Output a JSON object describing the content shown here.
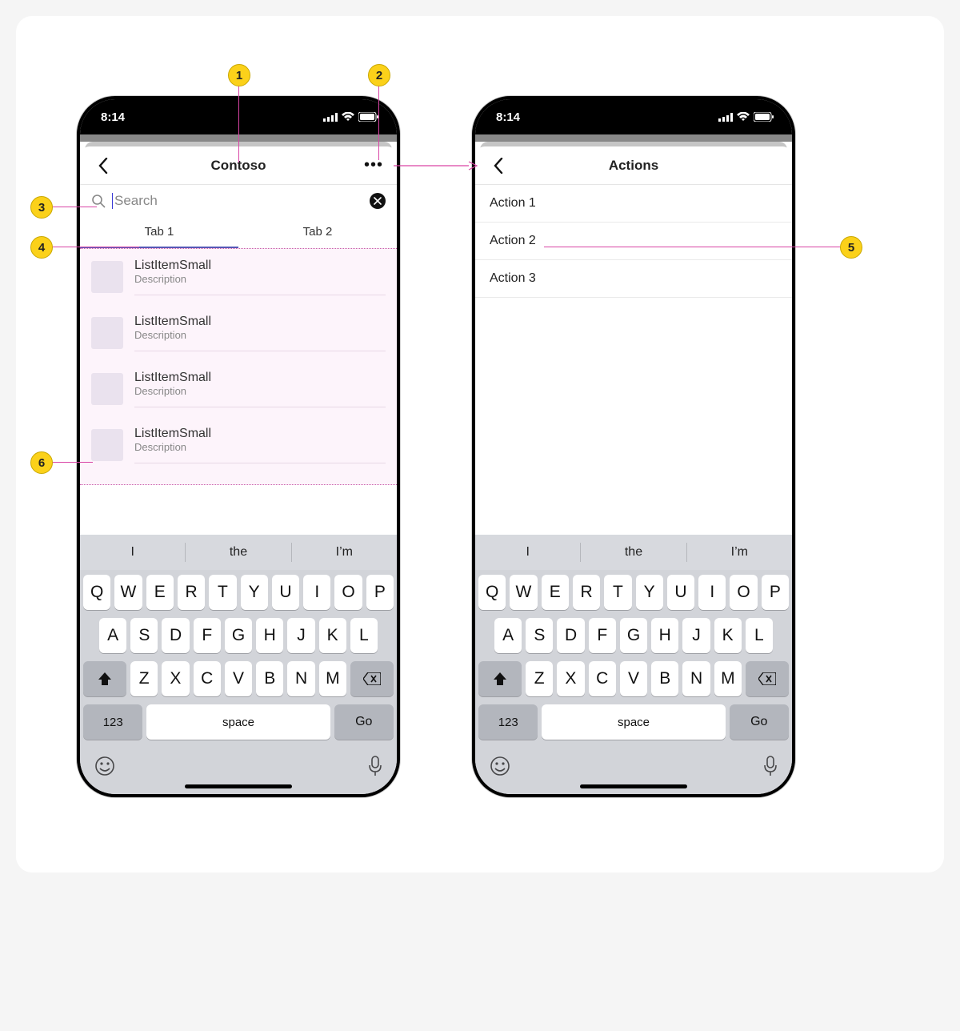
{
  "status_bar": {
    "time": "8:14"
  },
  "screen_left": {
    "nav_title": "Contoso",
    "search": {
      "placeholder": "Search",
      "value": ""
    },
    "tabs": [
      "Tab 1",
      "Tab 2"
    ],
    "active_tab_index": 0,
    "list_items": [
      {
        "title": "ListItemSmall",
        "description": "Description"
      },
      {
        "title": "ListItemSmall",
        "description": "Description"
      },
      {
        "title": "ListItemSmall",
        "description": "Description"
      },
      {
        "title": "ListItemSmall",
        "description": "Description"
      }
    ]
  },
  "screen_right": {
    "nav_title": "Actions",
    "actions": [
      "Action 1",
      "Action 2",
      "Action 3"
    ]
  },
  "keyboard": {
    "suggestions": [
      "I",
      "the",
      "I’m"
    ],
    "row1": [
      "Q",
      "W",
      "E",
      "R",
      "T",
      "Y",
      "U",
      "I",
      "O",
      "P"
    ],
    "row2": [
      "A",
      "S",
      "D",
      "F",
      "G",
      "H",
      "J",
      "K",
      "L"
    ],
    "row3": [
      "Z",
      "X",
      "C",
      "V",
      "B",
      "N",
      "M"
    ],
    "numeric_label": "123",
    "space_label": "space",
    "go_label": "Go"
  },
  "annotations": {
    "1": "1",
    "2": "2",
    "3": "3",
    "4": "4",
    "5": "5",
    "6": "6"
  }
}
